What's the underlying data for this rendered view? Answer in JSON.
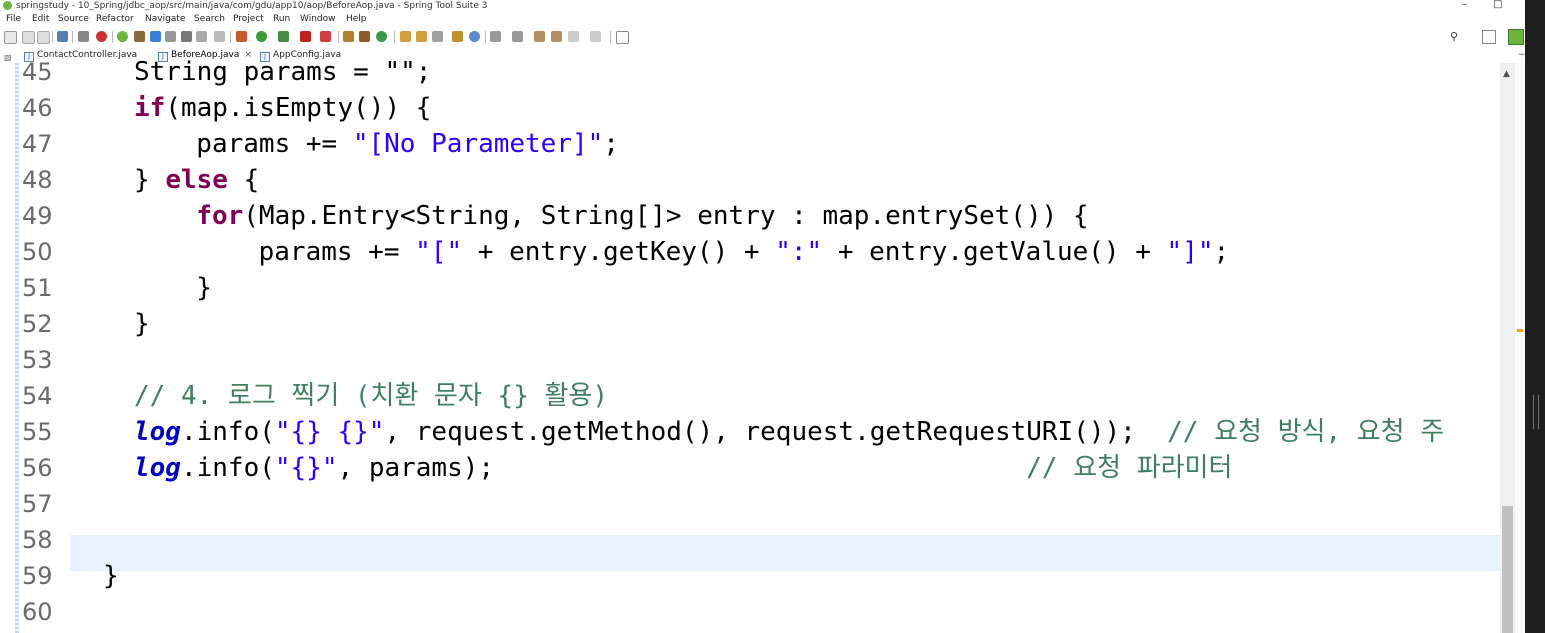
{
  "window": {
    "title": "springstudy - 10_Spring/jdbc_aop/src/main/java/com/gdu/app10/aop/BeforeAop.java - Spring Tool Suite 3",
    "minimize_glyph": "–",
    "maximize_glyph": "□",
    "close_glyph": "✕"
  },
  "menu": {
    "items": [
      "File",
      "Edit",
      "Source",
      "Refactor",
      "Navigate",
      "Search",
      "Project",
      "Run",
      "Window",
      "Help"
    ]
  },
  "tabs": [
    {
      "label": "ContactController.java",
      "active": false
    },
    {
      "label": "BeforeAop.java",
      "active": true,
      "close": "×"
    },
    {
      "label": "AppConfig.java",
      "active": false
    }
  ],
  "tab_controls": "− □",
  "editor": {
    "lines": [
      {
        "num": "45",
        "html": "<span>String params = \"\";</span>"
      },
      {
        "num": "46",
        "html": "<span class=\"kw\">if</span>(map.isEmpty()) {"
      },
      {
        "num": "47",
        "html": "  params += <span class=\"str\">\"[No Parameter]\"</span>;"
      },
      {
        "num": "48",
        "html": "} <span class=\"kw\">else</span> {"
      },
      {
        "num": "49",
        "html": "  <span class=\"kw\">for</span>(Map.Entry&lt;String, String[]&gt; entry : map.entrySet()) {"
      },
      {
        "num": "50",
        "html": "    params += <span class=\"str\">\"[\"</span> + entry.getKey() + <span class=\"str\">\":\"</span> + entry.getValue() + <span class=\"str\">\"]\"</span>;"
      },
      {
        "num": "51",
        "html": "  }"
      },
      {
        "num": "52",
        "html": "}"
      },
      {
        "num": "53",
        "html": ""
      },
      {
        "num": "54",
        "html": "<span class=\"cmt\">// 4. 로그 찍기 (치환 문자 {} 활용)</span>"
      },
      {
        "num": "55",
        "html": "<span class=\"log\">log</span>.info(<span class=\"str\">\"{} {}\"</span>, request.getMethod(), request.getRequestURI());  <span class=\"cmt\">// 요청 방식, 요청 주</span>"
      },
      {
        "num": "56",
        "html": "<span class=\"log\">log</span>.info(<span class=\"str\">\"{}\"</span>, params);                                  <span class=\"cmt\">// 요청 파라미터</span>"
      },
      {
        "num": "57",
        "html": ""
      },
      {
        "num": "58",
        "html": ""
      },
      {
        "num": "59",
        "html": "}"
      },
      {
        "num": "60",
        "html": ""
      }
    ]
  },
  "colors": {
    "keyword": "#7f0055",
    "string": "#2a00ff",
    "comment": "#3f7f5f",
    "static_field": "#0000c0",
    "current_line": "#e8f2fe"
  }
}
